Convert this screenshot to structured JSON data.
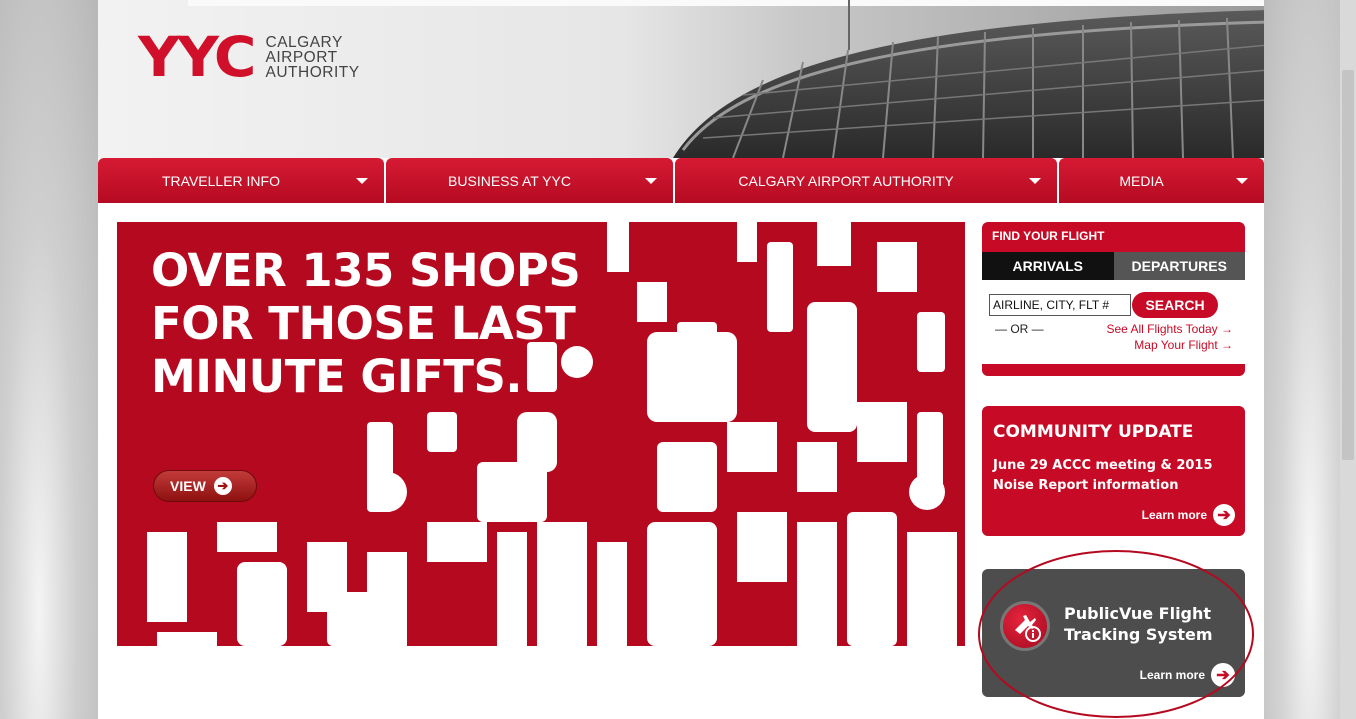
{
  "logo": {
    "mark": "YYC",
    "line1": "CALGARY",
    "line2": "AIRPORT",
    "line3": "AUTHORITY"
  },
  "nav": {
    "items": [
      {
        "label": "TRAVELLER INFO"
      },
      {
        "label": "BUSINESS AT YYC"
      },
      {
        "label": "CALGARY AIRPORT AUTHORITY"
      },
      {
        "label": "MEDIA"
      }
    ]
  },
  "banner": {
    "title": "OVER 135 SHOPS FOR THOSE LAST MINUTE GIFTS.",
    "button": "VIEW"
  },
  "flight": {
    "title": "FIND YOUR FLIGHT",
    "tab_arrivals": "ARRIVALS",
    "tab_departures": "DEPARTURES",
    "input_placeholder": "AIRLINE, CITY, FLT #",
    "search": "SEARCH",
    "or": "— OR —",
    "link_all": "See All Flights Today →",
    "link_map": "Map Your Flight →"
  },
  "community": {
    "title": "COMMUNITY UPDATE",
    "body": "June 29 ACCC meeting & 2015 Noise Report information",
    "learn": "Learn more"
  },
  "publicvue": {
    "title_line1": "PublicVue Flight",
    "title_line2": "Tracking System",
    "learn": "Learn more"
  },
  "colors": {
    "brand_red": "#c70a25",
    "dark_gray": "#4d4d4d"
  }
}
